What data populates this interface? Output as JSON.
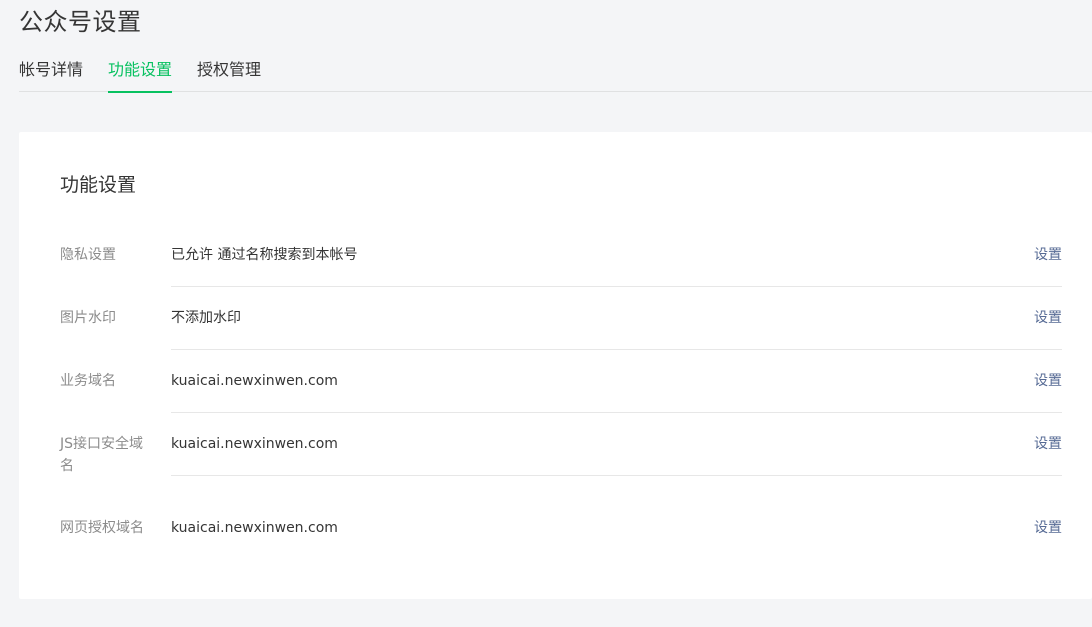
{
  "page_title": "公众号设置",
  "tabs": [
    {
      "label": "帐号详情",
      "active": false
    },
    {
      "label": "功能设置",
      "active": true
    },
    {
      "label": "授权管理",
      "active": false
    }
  ],
  "card": {
    "title": "功能设置",
    "rows": [
      {
        "label": "隐私设置",
        "value": "已允许 通过名称搜索到本帐号",
        "action": "设置"
      },
      {
        "label": "图片水印",
        "value": "不添加水印",
        "action": "设置"
      },
      {
        "label": "业务域名",
        "value": "kuaicai.newxinwen.com",
        "action": "设置"
      },
      {
        "label": "JS接口安全域名",
        "value": "kuaicai.newxinwen.com",
        "action": "设置"
      },
      {
        "label": "网页授权域名",
        "value": "kuaicai.newxinwen.com",
        "action": "设置"
      }
    ]
  },
  "colors": {
    "accent_green": "#07c160",
    "link_blue": "#576b95",
    "label_gray": "#8c8c8c",
    "text": "#353535",
    "background": "#f4f5f7"
  }
}
